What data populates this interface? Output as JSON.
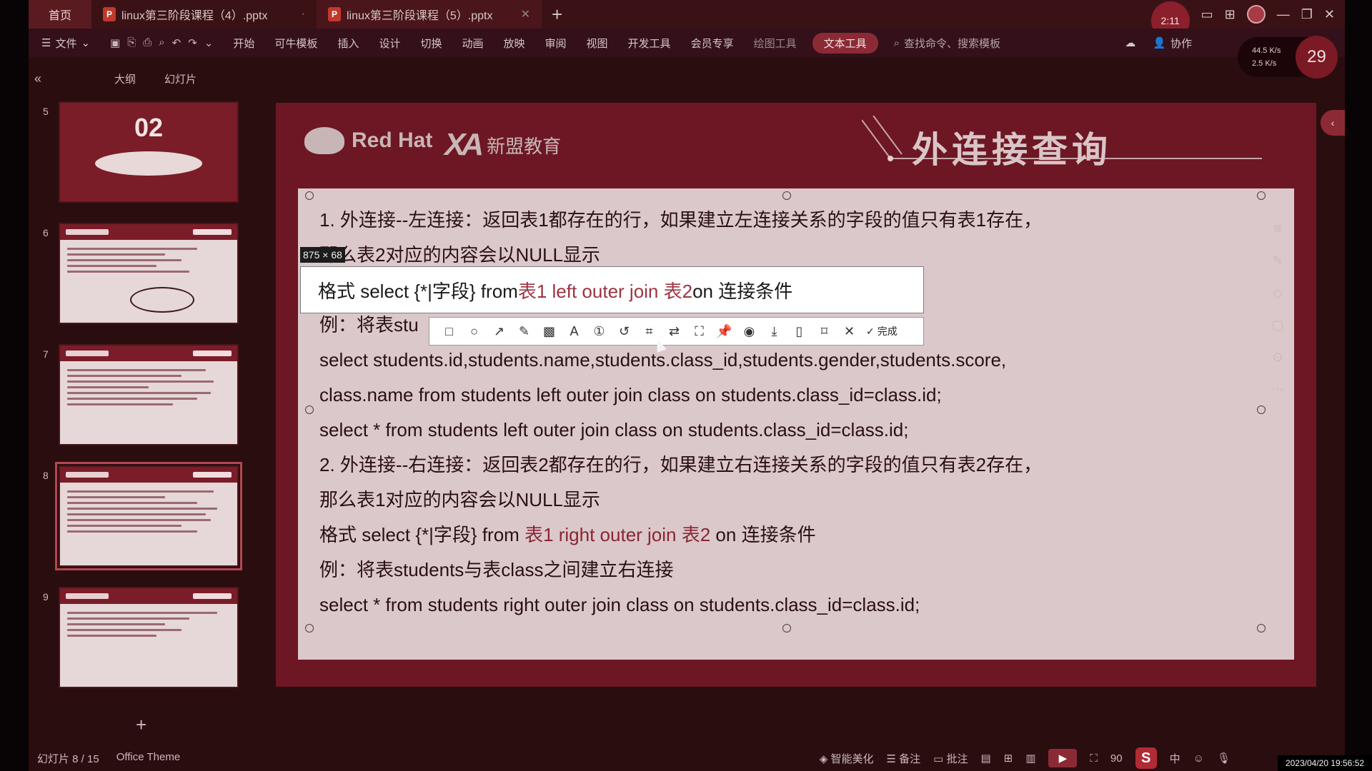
{
  "tabs": {
    "home": "首页",
    "docs": [
      {
        "title": "linux第三阶段课程（4）.pptx",
        "active": false
      },
      {
        "title": "linux第三阶段课程（5）.pptx",
        "active": true
      }
    ],
    "timer": "2:11"
  },
  "menu": {
    "file": "文件",
    "items": [
      "开始",
      "可牛模板",
      "插入",
      "设计",
      "切换",
      "动画",
      "放映",
      "审阅",
      "视图",
      "开发工具",
      "会员专享"
    ],
    "drawing_tools": "绘图工具",
    "text_tools": "文本工具",
    "search": "查找命令、搜索模板",
    "collab": "协作"
  },
  "netspeed": {
    "up": "44.5 K/s",
    "down": "2.5 K/s",
    "value": "29"
  },
  "panel": {
    "outline": "大纲",
    "slides": "幻灯片"
  },
  "thumbnails": [
    {
      "num": "5",
      "type": "cover",
      "big": "02"
    },
    {
      "num": "6",
      "type": "content"
    },
    {
      "num": "7",
      "type": "content"
    },
    {
      "num": "8",
      "type": "content",
      "selected": true
    },
    {
      "num": "9",
      "type": "content"
    }
  ],
  "slide": {
    "brand1": "Red Hat",
    "brand2": "新盟教育",
    "title": "外连接查询",
    "lines": [
      "1. 外连接--左连接：返回表1都存在的行，如果建立左连接关系的字段的值只有表1存在，",
      "那么表2对应的内容会以NULL显示",
      "格式 select {*|字段} from 表1 left outer join 表2 on 连接条件",
      "例：将表students与表class之间建立左连接",
      "select students.id,students.name,students.class_id,students.gender,students.score,",
      "class.name from students left outer join class on students.class_id=class.id;",
      "select * from students left outer join class on students.class_id=class.id;",
      "2. 外连接--右连接：返回表2都存在的行，如果建立右连接关系的字段的值只有表2存在，",
      "那么表1对应的内容会以NULL显示",
      "格式 select {*|字段} from ",
      "例：将表students与表class之间建立右连接",
      "select * from students right outer join class on students.class_id=class.id;"
    ],
    "line3_prefix": "格式 select {*|字段} from ",
    "line3_hl": "表1 left outer join 表2",
    "line3_suffix": " on 连接条件",
    "line9_prefix": "格式 select {*|字段} from ",
    "line9_hl": "表1 right outer join 表2",
    "line9_suffix": " on 连接条件",
    "line4_visible": "例：将表stu"
  },
  "capture": {
    "size": "875 × 68",
    "tools": [
      "rect-icon",
      "circle-icon",
      "arrow-icon",
      "pen-icon",
      "mosaic-icon",
      "text-icon",
      "number-icon",
      "undo-icon",
      "ocr-icon",
      "translate-icon",
      "scroll-capture-icon",
      "pin-icon",
      "record-icon",
      "download-icon",
      "phone-icon",
      "bookmark-icon",
      "close-icon"
    ],
    "done": "完成"
  },
  "status": {
    "slide_pos": "幻灯片 8 / 15",
    "theme": "Office Theme",
    "beautify": "智能美化",
    "notes": "备注",
    "comments": "批注",
    "zoom": "90",
    "lang": "中",
    "datetime": "2023/04/20 19:56:52"
  },
  "colors": {
    "accent": "#8b2a35",
    "slide_bg": "#6d1724",
    "highlight": "#8a2533"
  }
}
